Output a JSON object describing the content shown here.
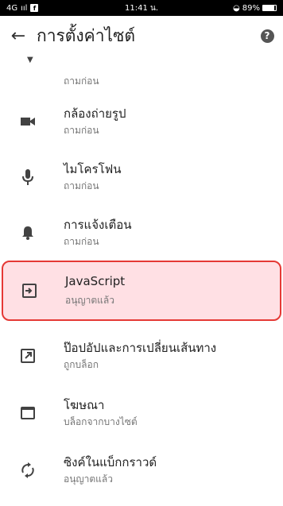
{
  "status_bar": {
    "network": "4G",
    "signal": "ııl",
    "fb": "f",
    "time": "11:41 น.",
    "wifi": "◒",
    "battery": "89%"
  },
  "app_bar": {
    "back_icon": "←",
    "title": "การตั้งค่าไซต์",
    "help_icon": "?"
  },
  "top_partial": {
    "sub": "ถามก่อน"
  },
  "items": [
    {
      "label": "กล้องถ่ายรูป",
      "sub": "ถามก่อน",
      "icon": "camera-icon"
    },
    {
      "label": "ไมโครโฟน",
      "sub": "ถามก่อน",
      "icon": "microphone-icon"
    },
    {
      "label": "การแจ้งเตือน",
      "sub": "ถามก่อน",
      "icon": "bell-icon"
    },
    {
      "label": "JavaScript",
      "sub": "อนุญาตแล้ว",
      "icon": "javascript-icon"
    },
    {
      "label": "ป๊อปอัปและการเปลี่ยนเส้นทาง",
      "sub": "ถูกบล็อก",
      "icon": "popup-icon"
    },
    {
      "label": "โฆษณา",
      "sub": "บล็อกจากบางไซต์",
      "icon": "ads-icon"
    },
    {
      "label": "ซิงค์ในแบ็กกราวด์",
      "sub": "อนุญาตแล้ว",
      "icon": "sync-icon"
    }
  ],
  "highlight_color": "#e53935"
}
